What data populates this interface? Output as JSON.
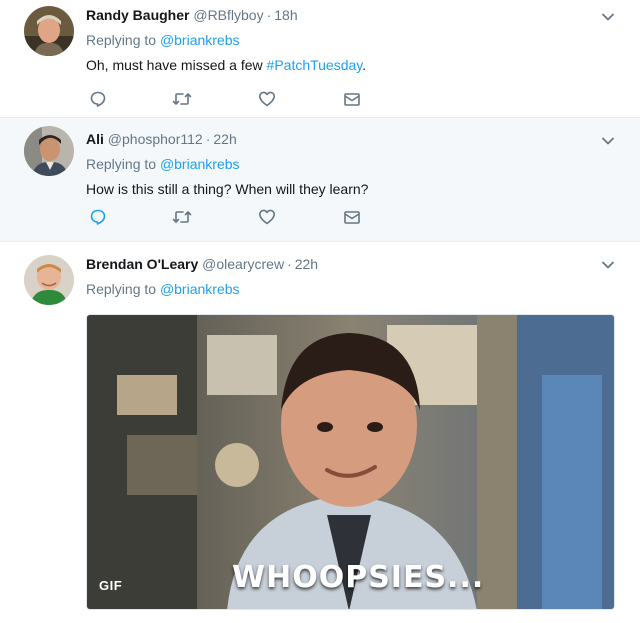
{
  "tweets": [
    {
      "fullname": "Randy Baugher",
      "handle": "@RBflyboy",
      "separator": "·",
      "time": "18h",
      "replying_prefix": "Replying to",
      "replying_to": "@briankrebs",
      "text_before": "Oh, must have missed a few ",
      "hashtag": "#PatchTuesday",
      "text_after": "."
    },
    {
      "fullname": "Ali",
      "handle": "@phosphor112",
      "separator": "·",
      "time": "22h",
      "replying_prefix": "Replying to",
      "replying_to": "@briankrebs",
      "text": "How is this still a thing? When will they learn?"
    },
    {
      "fullname": "Brendan O'Leary",
      "handle": "@olearycrew",
      "separator": "·",
      "time": "22h",
      "replying_prefix": "Replying to",
      "replying_to": "@briankrebs",
      "media": {
        "badge": "GIF",
        "caption": "WHOOPSIES..."
      }
    }
  ],
  "icons": {
    "reply": "reply-icon",
    "retweet": "retweet-icon",
    "like": "heart-icon",
    "dm": "envelope-icon",
    "more": "chevron-down-icon"
  },
  "colors": {
    "link": "#1da1f2",
    "secondary_text": "#657786",
    "hover_background": "#f5f8fa",
    "divider": "#e6ecf0"
  }
}
